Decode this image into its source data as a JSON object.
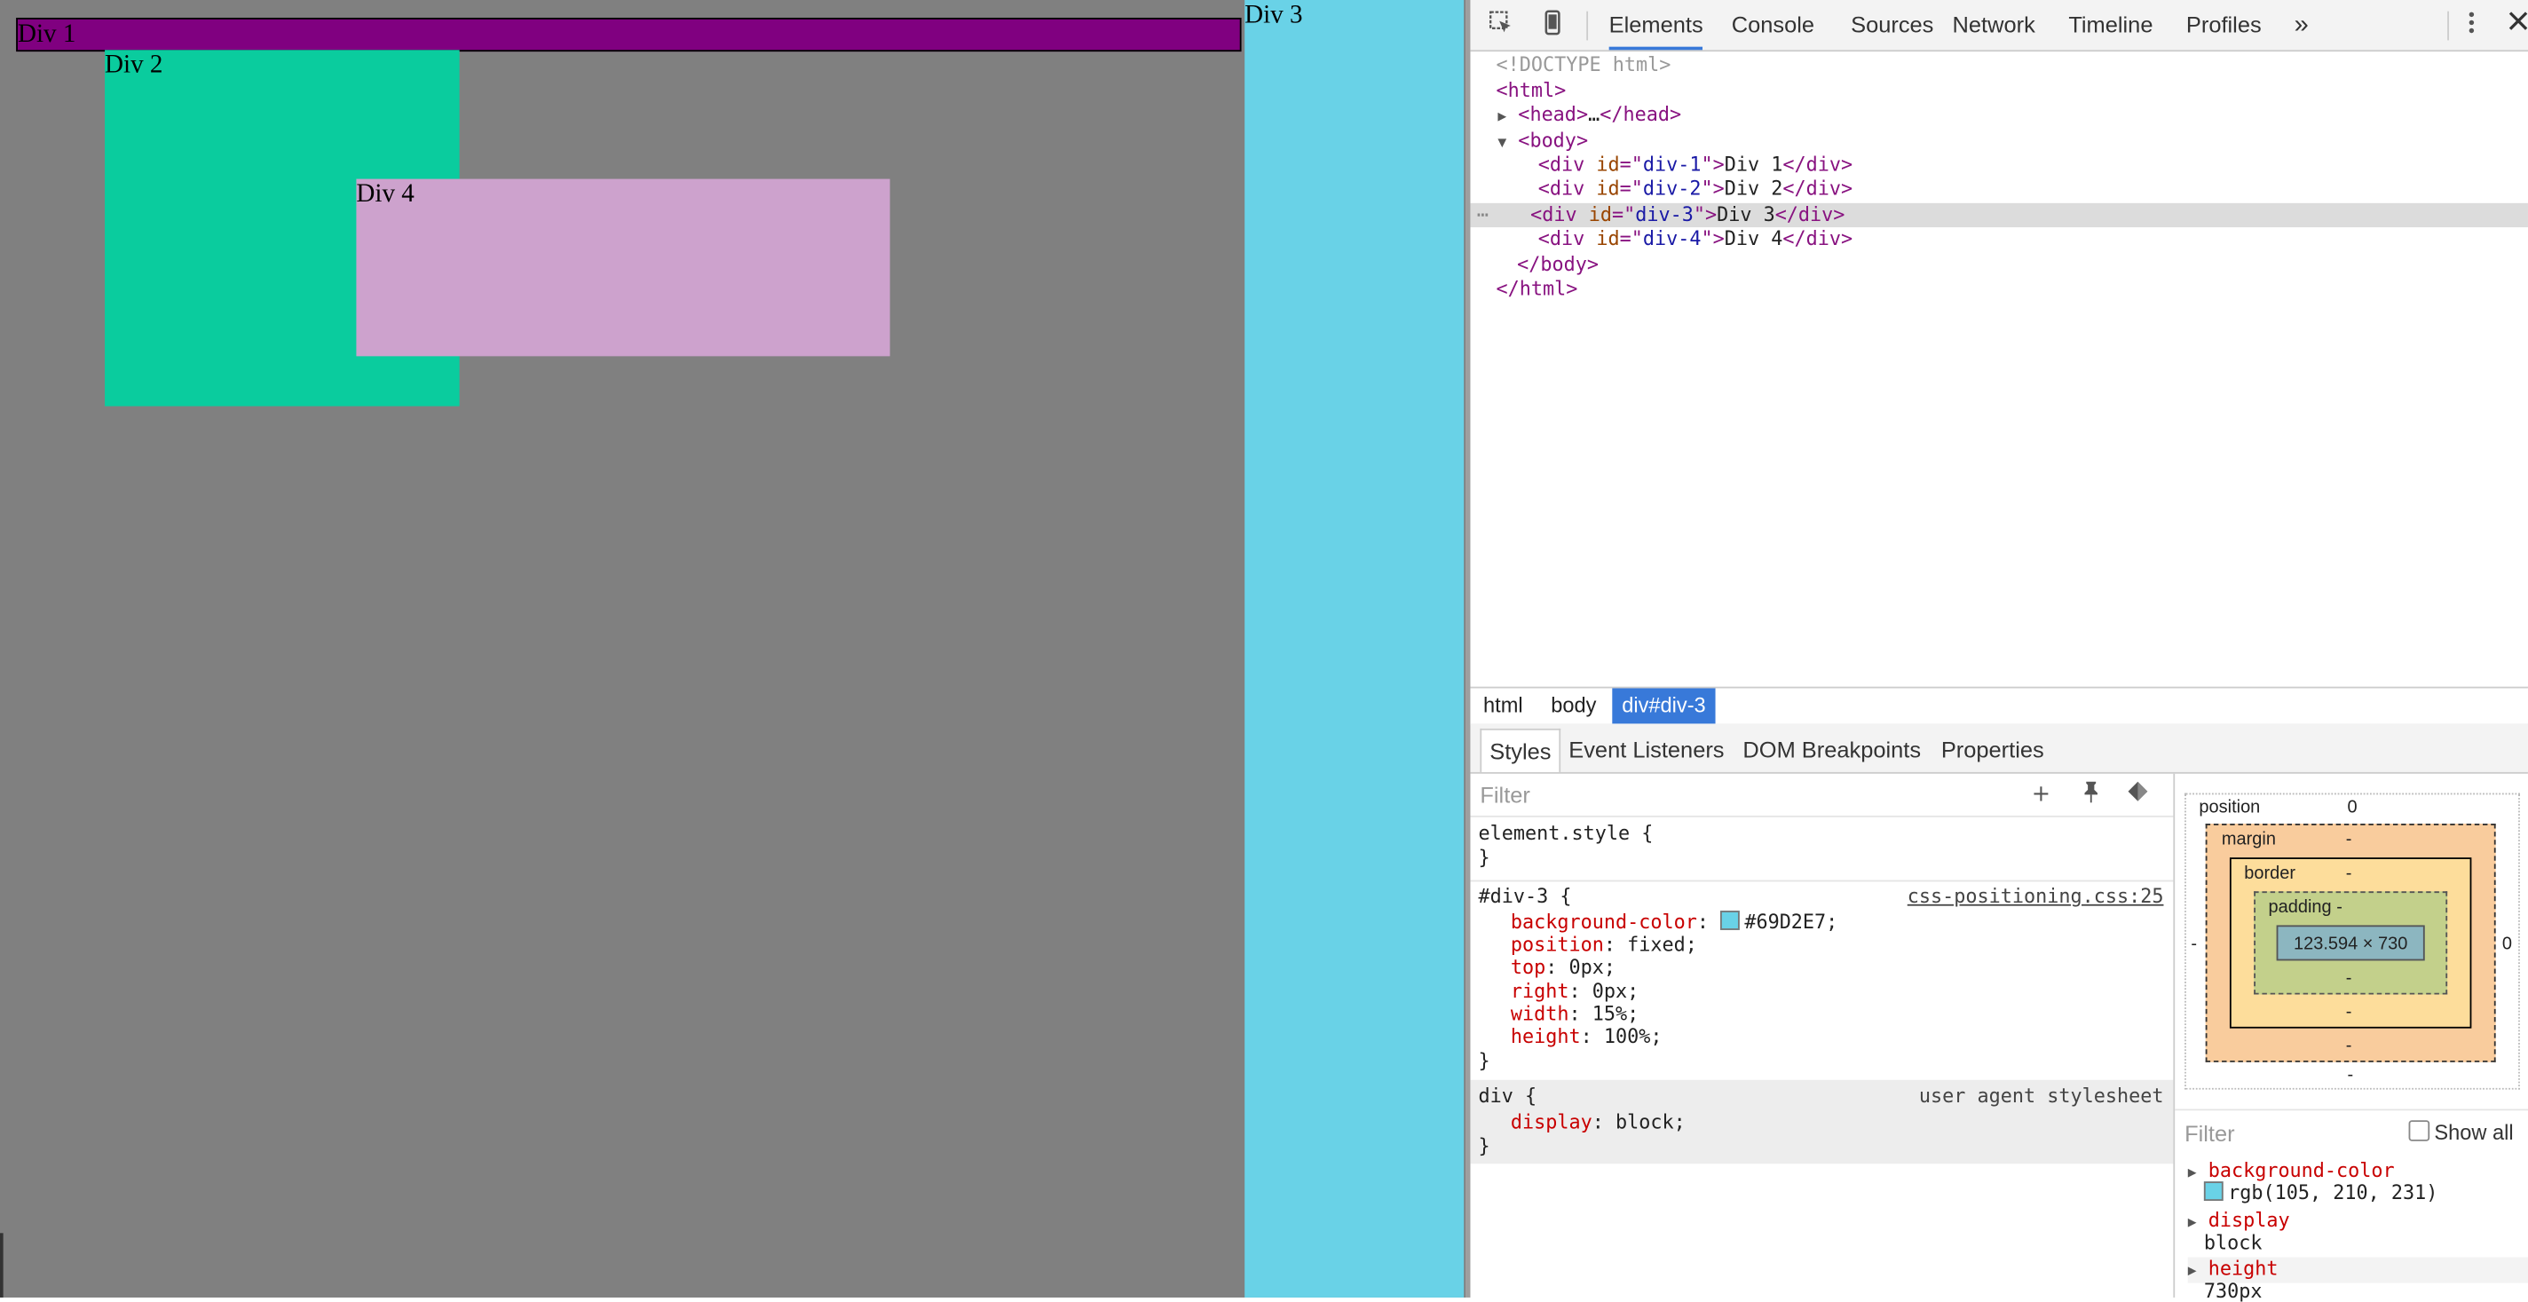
{
  "page": {
    "div1": "Div 1",
    "div2": "Div 2",
    "div3": "Div 3",
    "div4": "Div 4"
  },
  "toolbar": {
    "tabs": [
      "Elements",
      "Console",
      "Sources",
      "Network",
      "Timeline",
      "Profiles"
    ],
    "more": "»",
    "active_tab": "Elements"
  },
  "dom": {
    "doctype": "<!DOCTYPE html>",
    "html_open": "html",
    "head": "head",
    "head_ellipsis": "…",
    "body": "body",
    "divs": [
      {
        "id": "div-1",
        "text": "Div 1"
      },
      {
        "id": "div-2",
        "text": "Div 2"
      },
      {
        "id": "div-3",
        "text": "Div 3"
      },
      {
        "id": "div-4",
        "text": "Div 4"
      }
    ],
    "selected_index": 2
  },
  "breadcrumbs": [
    "html",
    "body",
    "div#div-3"
  ],
  "subtabs": [
    "Styles",
    "Event Listeners",
    "DOM Breakpoints",
    "Properties"
  ],
  "styles": {
    "filter_placeholder": "Filter",
    "element_style": "element.style {",
    "rule_selector": "#div-3 {",
    "rule_source": "css-positioning.css:25",
    "props": [
      {
        "name": "background-color",
        "value": "#69D2E7;"
      },
      {
        "name": "position",
        "value": "fixed;"
      },
      {
        "name": "top",
        "value": "0px;"
      },
      {
        "name": "right",
        "value": "0px;"
      },
      {
        "name": "width",
        "value": "15%;"
      },
      {
        "name": "height",
        "value": "100%;"
      }
    ],
    "ua_selector": "div {",
    "ua_source": "user agent stylesheet",
    "ua_prop": {
      "name": "display",
      "value": "block;"
    },
    "close": "}"
  },
  "boxmodel": {
    "position_label": "position",
    "position_value": "0",
    "margin_label": "margin",
    "border_label": "border",
    "padding_label": "padding -",
    "content": "123.594 × 730",
    "dash": "-",
    "right_value": "0"
  },
  "computed": {
    "filter_placeholder": "Filter",
    "show_all": "Show all",
    "props": [
      {
        "name": "background-color",
        "value": "rgb(105, 210, 231)"
      },
      {
        "name": "display",
        "value": "block"
      },
      {
        "name": "height",
        "value": "730px"
      }
    ]
  },
  "colors": {
    "div1": "#800080",
    "div2": "#0ACC9E",
    "div3": "#69D2E7",
    "div4": "#CDA2CD",
    "page_bg": "#808080",
    "accent": "#3879d9"
  }
}
